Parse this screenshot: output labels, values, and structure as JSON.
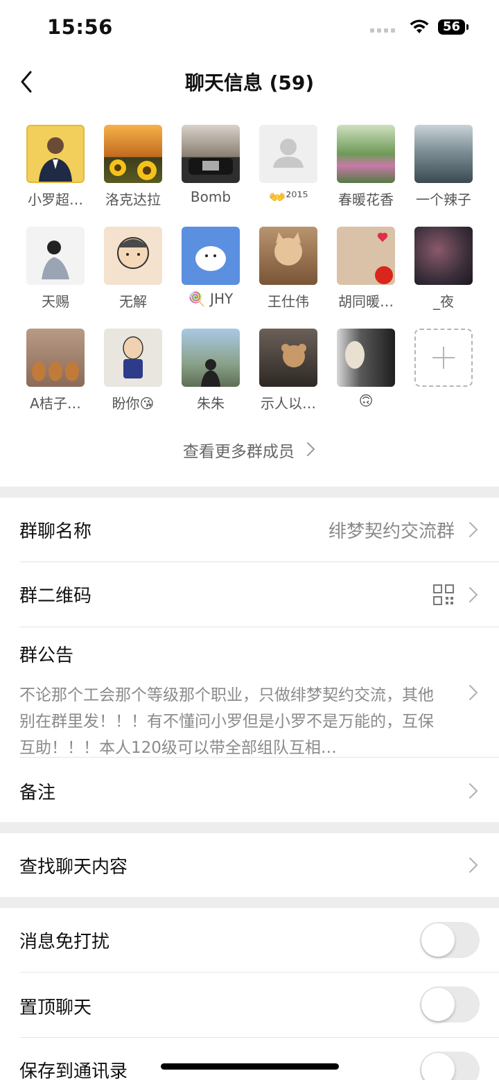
{
  "status": {
    "time": "15:56",
    "battery": "56"
  },
  "nav": {
    "title": "聊天信息 (59)"
  },
  "members": [
    {
      "name": "小罗超…",
      "avatar_color": "#f2cf5a"
    },
    {
      "name": "洛克达拉",
      "avatar_color": "#d78a2b"
    },
    {
      "name": "Bomb",
      "avatar_color": "#3a3a3a"
    },
    {
      "name": "👐²⁰¹⁵",
      "avatar_color": "#efefef"
    },
    {
      "name": "春暖花香",
      "avatar_color": "#6e9a57"
    },
    {
      "name": "一个辣子",
      "avatar_color": "#5c6f78"
    },
    {
      "name": "天赐",
      "avatar_color": "#f3f3f3"
    },
    {
      "name": "无解",
      "avatar_color": "#f4e2cf"
    },
    {
      "name": "🍭 JHY",
      "avatar_color": "#5b8fe0"
    },
    {
      "name": "王仕伟",
      "avatar_color": "#a8734a"
    },
    {
      "name": "胡同暖…",
      "avatar_color": "#d9c2a7"
    },
    {
      "name": "_夜",
      "avatar_color": "#3b2f3a"
    },
    {
      "name": "A桔子…",
      "avatar_color": "#8a6a58"
    },
    {
      "name": "盼你😘",
      "avatar_color": "#e9e6df"
    },
    {
      "name": "朱朱",
      "avatar_color": "#6f9cc4"
    },
    {
      "name": "示人以…",
      "avatar_color": "#4a4038"
    },
    {
      "name": "🙃",
      "avatar_color": "#5a5a5a"
    }
  ],
  "see_more": "查看更多群成员",
  "settings": {
    "group_name_label": "群聊名称",
    "group_name_value": "绯梦契约交流群",
    "qr_label": "群二维码",
    "notice_label": "群公告",
    "notice_text": "不论那个工会那个等级那个职业，只做绯梦契约交流，其他别在群里发！！！有不懂问小罗但是小罗不是万能的，互保互助！！！本人120级可以带全部组队互相…",
    "remark_label": "备注",
    "search_label": "查找聊天内容",
    "mute_label": "消息免打扰",
    "pin_label": "置顶聊天",
    "save_label": "保存到通讯录"
  }
}
